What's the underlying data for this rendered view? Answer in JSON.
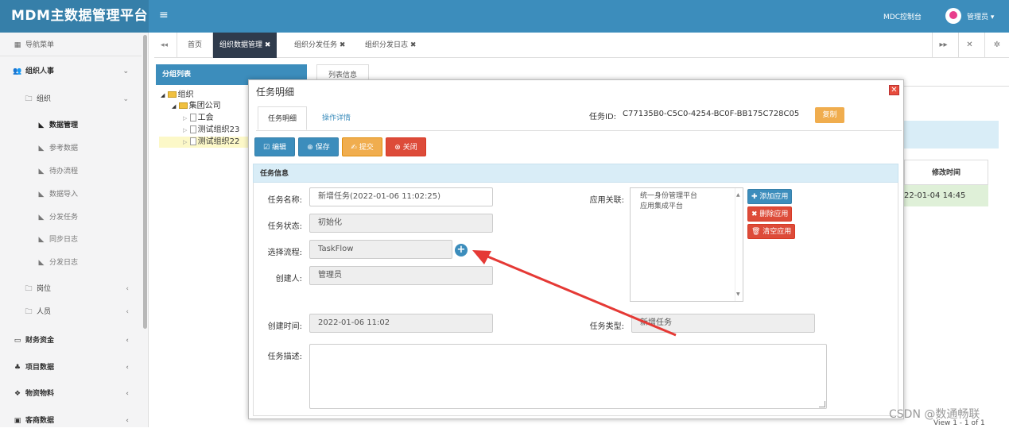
{
  "header": {
    "brand": "MDM主数据管理平台",
    "menu_icon": "≡",
    "mdc_link": "MDC控制台",
    "user": "管理员 ▾"
  },
  "sidebar": {
    "nav_header": "导航菜单",
    "groups": [
      {
        "label": "组织人事",
        "chevron": "⌄"
      },
      {
        "label": "组织",
        "chevron": "⌄"
      }
    ],
    "sub_items": [
      "数据管理",
      "参考数据",
      "待办流程",
      "数据导入",
      "分发任务",
      "同步日志",
      "分发日志"
    ],
    "lower_items": [
      {
        "label": "岗位",
        "chevron": "‹"
      },
      {
        "label": "人员",
        "chevron": "‹"
      }
    ],
    "bottom_groups": [
      {
        "label": "财务资金",
        "chevron": "‹"
      },
      {
        "label": "项目数据",
        "chevron": "‹"
      },
      {
        "label": "物资物料",
        "chevron": "‹"
      },
      {
        "label": "客商数据",
        "chevron": "‹"
      }
    ]
  },
  "tabs": {
    "back": "◂◂",
    "home": "首页",
    "items": [
      "组织数据管理 ✖",
      "组织分发任务 ✖",
      "组织分发日志 ✖"
    ],
    "forward": "▸▸",
    "fullscreen": "✕",
    "settings": "✲"
  },
  "tree": {
    "header": "分组列表",
    "list_tab": "列表信息",
    "nodes": [
      "组织",
      "集团公司",
      "工会",
      "测试组织23",
      "测试组织22"
    ]
  },
  "background": {
    "grid_header": "修改时间",
    "grid_cell": "22-01-04 14:45",
    "footer": "View 1 - 1 of 1",
    "watermark": "CSDN @数通畅联"
  },
  "modal": {
    "title": "任务明细",
    "close": "✕",
    "tabs": [
      "任务明细",
      "操作详情"
    ],
    "task_id_label": "任务ID:",
    "task_id_value": "C77135B0-C5C0-4254-BC0F-BB175C728C05",
    "copy": "复制",
    "buttons": {
      "edit": "☑ 编辑",
      "save": "⊕ 保存",
      "submit": "✍ 提交",
      "close": "⊗ 关闭"
    },
    "section": "任务信息",
    "fields": {
      "name_label": "任务名称:",
      "name_value": "新增任务(2022-01-06 11:02:25)",
      "status_label": "任务状态:",
      "status_value": "初始化",
      "flow_label": "选择流程:",
      "flow_value": "TaskFlow",
      "creator_label": "创建人:",
      "creator_value": "管理员",
      "created_label": "创建时间:",
      "created_value": "2022-01-06 11:02",
      "type_label": "任务类型:",
      "type_value": "新增任务",
      "desc_label": "任务描述:",
      "apps_label": "应用关联:",
      "apps": [
        "统一身份管理平台",
        "应用集成平台"
      ]
    },
    "app_buttons": {
      "add": "✚ 添加应用",
      "remove": "✖ 删除应用",
      "clear": "🗑 清空应用"
    }
  },
  "colors": {
    "header": "#3c8dbc",
    "brand_bg": "#367fa9",
    "active_tab": "#2f3b4c",
    "arrow": "#e53935"
  }
}
